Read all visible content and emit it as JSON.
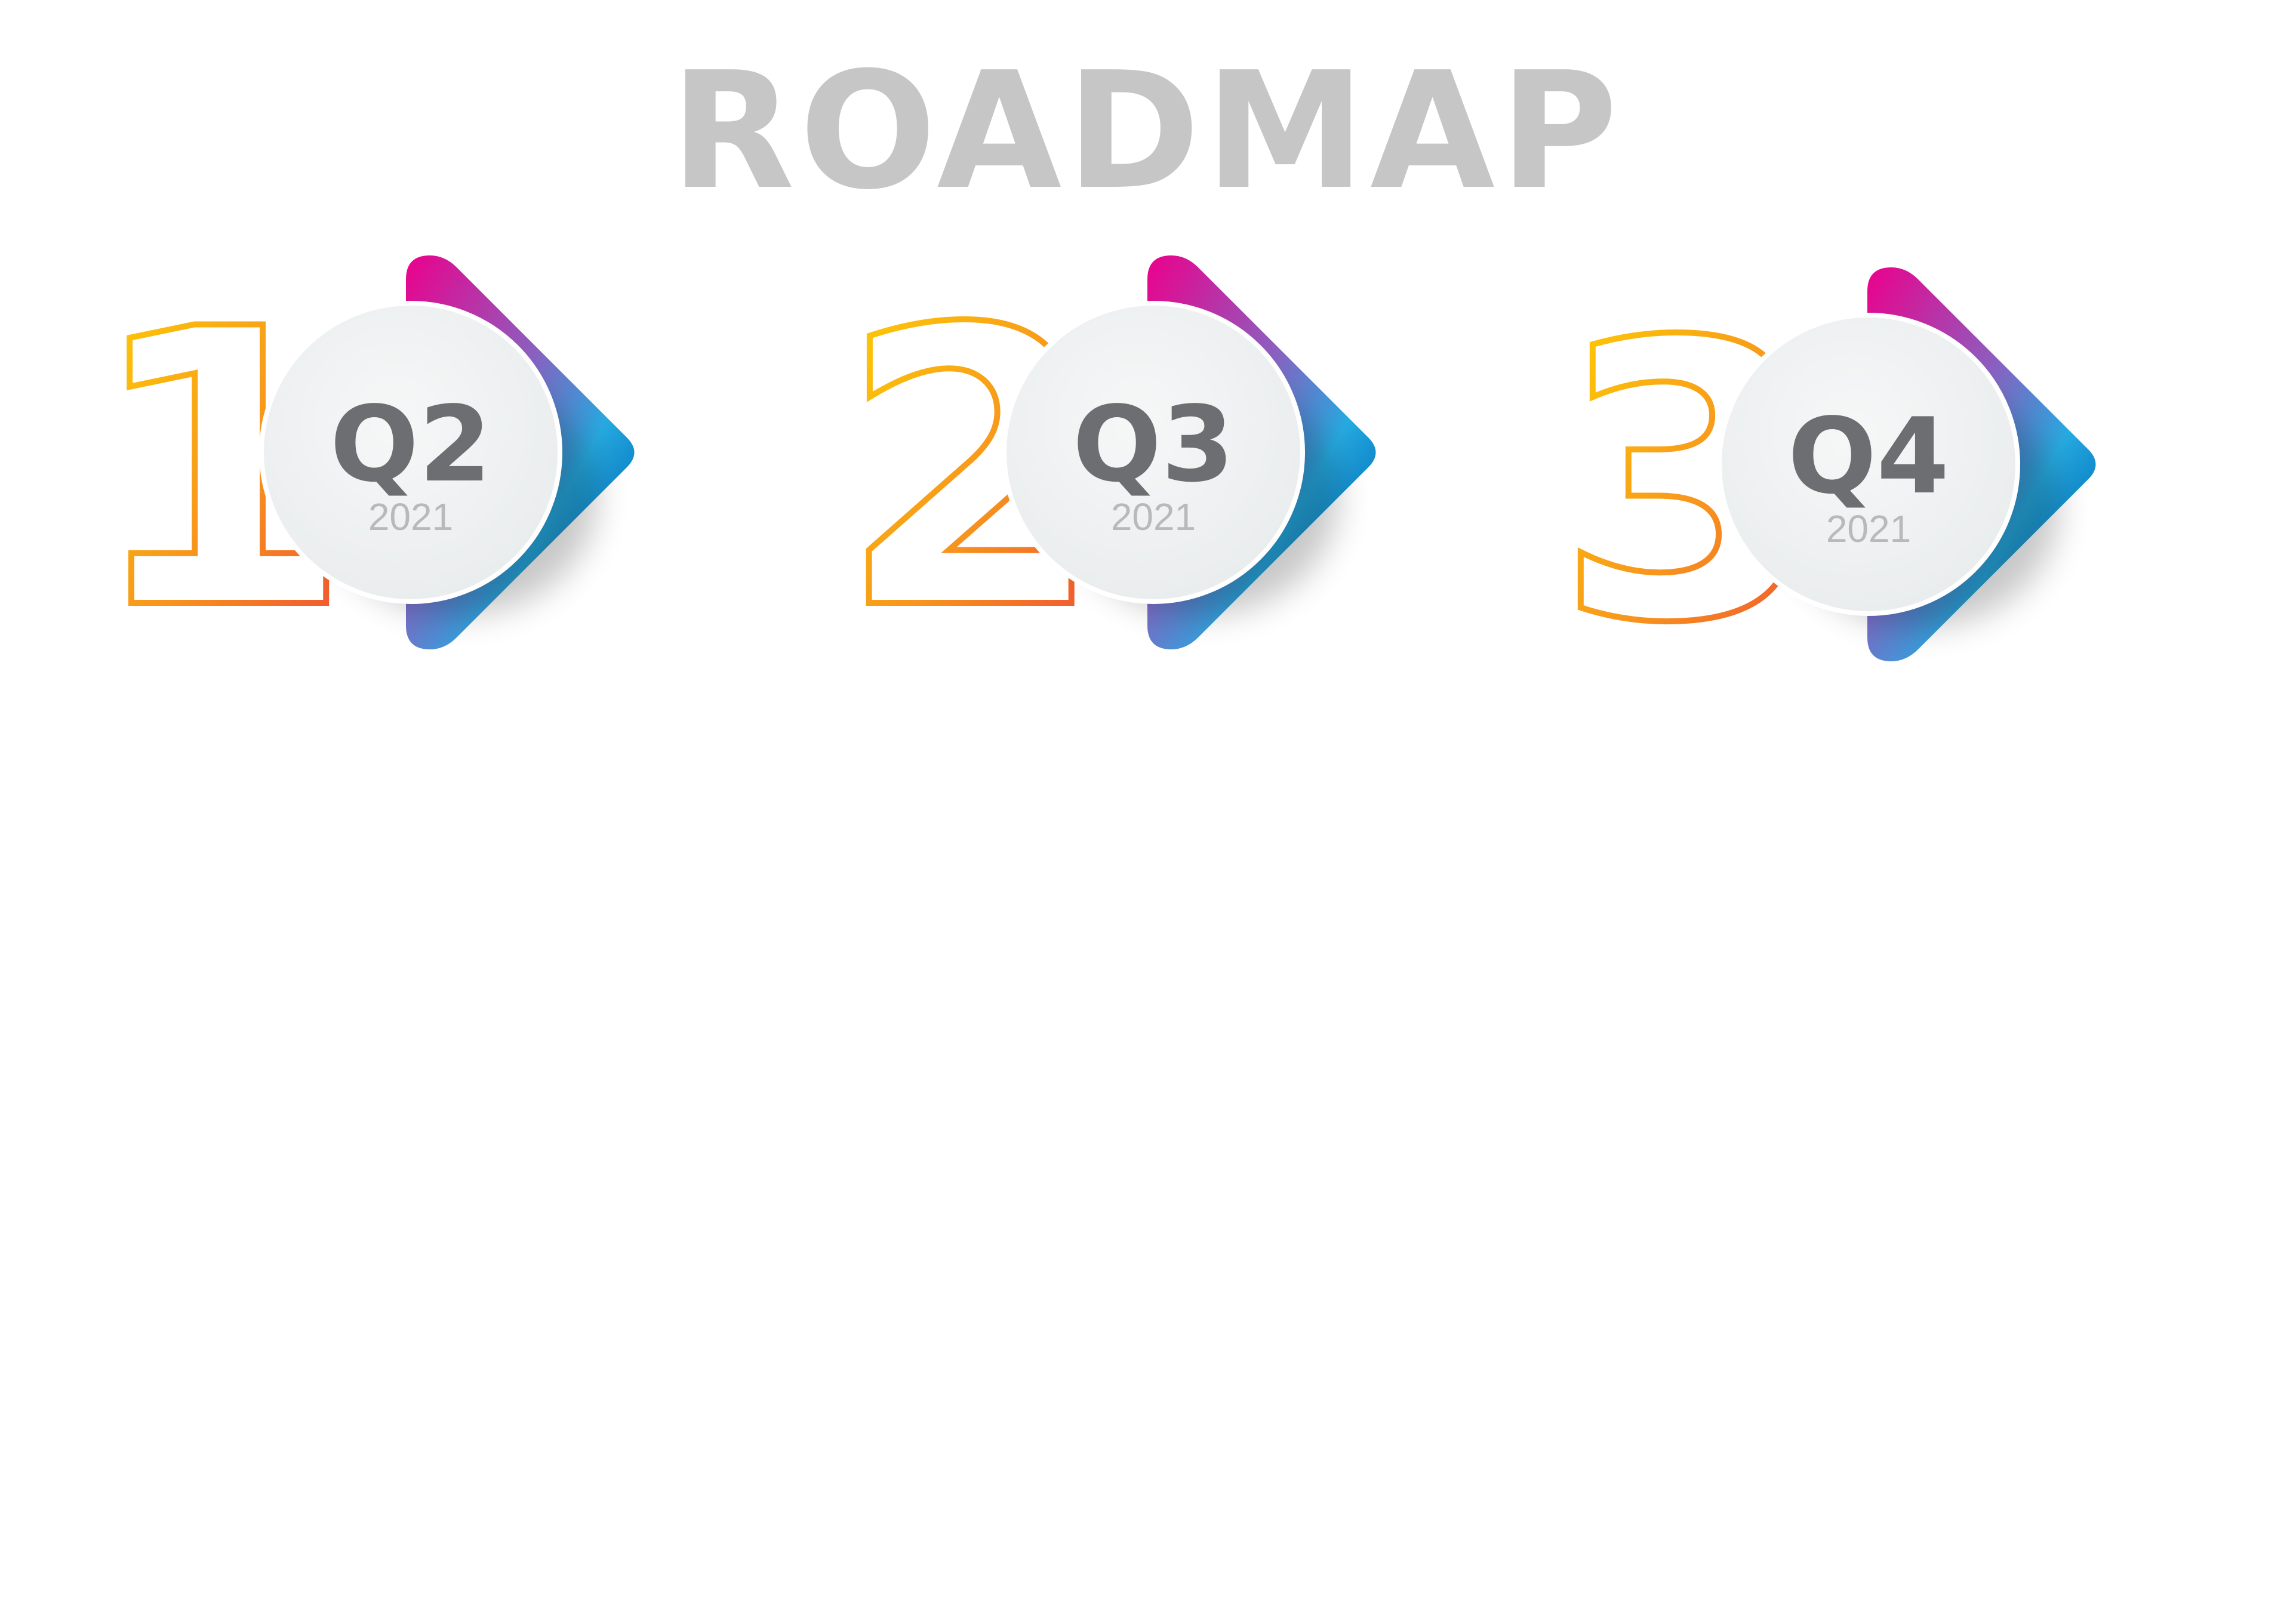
{
  "title": "ROADMAP",
  "colors": {
    "title": "#c6c6c6",
    "quarter_text": "#6d6e71",
    "year_text": "#b7b9bb",
    "circle_fill": "#f1f3f4",
    "outline_gradient": [
      "#fed500",
      "#f7941d",
      "#ef4136"
    ],
    "arrow_gradient": [
      "#ec008c",
      "#8b5fbf",
      "#27aae1",
      "#0072bc"
    ]
  },
  "steps": [
    {
      "number": "1",
      "quarter": "Q2",
      "year": "2021"
    },
    {
      "number": "2",
      "quarter": "Q3",
      "year": "2021"
    },
    {
      "number": "3",
      "quarter": "Q4",
      "year": "2021"
    }
  ]
}
